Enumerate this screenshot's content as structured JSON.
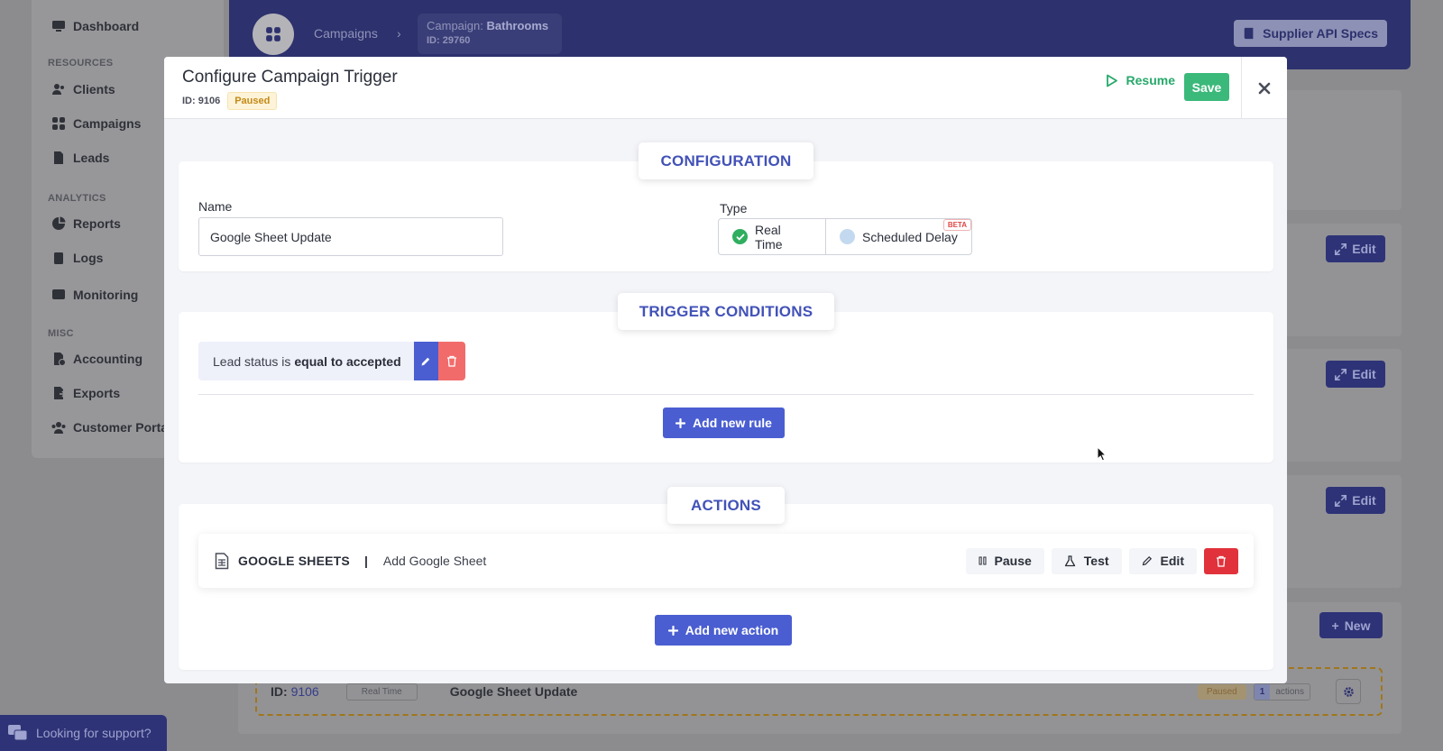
{
  "sidebar": {
    "items": [
      {
        "label": "Dashboard",
        "icon": "monitor-icon"
      },
      {
        "label": "Clients",
        "icon": "users-icon"
      },
      {
        "label": "Campaigns",
        "icon": "grid-icon"
      },
      {
        "label": "Leads",
        "icon": "file-icon"
      },
      {
        "label": "Reports",
        "icon": "pie-icon"
      },
      {
        "label": "Logs",
        "icon": "clipboard-icon"
      },
      {
        "label": "Monitoring",
        "icon": "monitor-heart-icon"
      },
      {
        "label": "Accounting",
        "icon": "dollar-icon"
      },
      {
        "label": "Exports",
        "icon": "export-icon"
      },
      {
        "label": "Customer Porta",
        "icon": "group-icon"
      }
    ],
    "sections": {
      "resources": "RESOURCES",
      "analytics": "ANALYTICS",
      "misc": "MISC"
    }
  },
  "topbar": {
    "breadcrumb_campaigns": "Campaigns",
    "campaign_prefix": "Campaign:",
    "campaign_name": "Bathrooms",
    "campaign_id": "ID: 29760",
    "api_specs_label": "Supplier API Specs"
  },
  "background": {
    "edit_label": "Edit",
    "new_label": "New",
    "row": {
      "id_prefix": "ID:",
      "id_value": "9106",
      "type": "Real Time",
      "name": "Google Sheet Update",
      "status": "Paused",
      "actions_count": "1",
      "actions_label": "actions"
    },
    "support_label": "Looking for support?"
  },
  "modal": {
    "title": "Configure Campaign Trigger",
    "id_text": "ID: 9106",
    "status_badge": "Paused",
    "resume_label": "Resume",
    "save_label": "Save",
    "configuration": {
      "section_title": "CONFIGURATION",
      "name_label": "Name",
      "name_value": "Google Sheet Update",
      "type_label": "Type",
      "type_options": [
        "Real Time",
        "Scheduled Delay"
      ],
      "selected_type": "Real Time",
      "beta_badge": "BETA"
    },
    "trigger_conditions": {
      "section_title": "TRIGGER CONDITIONS",
      "rule_prefix": "Lead status is",
      "rule_emphasis": "equal to accepted",
      "add_rule_label": "Add new rule"
    },
    "actions": {
      "section_title": "ACTIONS",
      "items": [
        {
          "service": "GOOGLE SHEETS",
          "separator": "|",
          "description": "Add Google Sheet"
        }
      ],
      "pause_label": "Pause",
      "test_label": "Test",
      "edit_label": "Edit",
      "add_action_label": "Add new action"
    }
  },
  "colors": {
    "accent": "#4a5ed1",
    "success": "#3bb97a",
    "danger": "#e1323b",
    "warning_badge": "#c48a17",
    "section_title": "#4252b8"
  }
}
